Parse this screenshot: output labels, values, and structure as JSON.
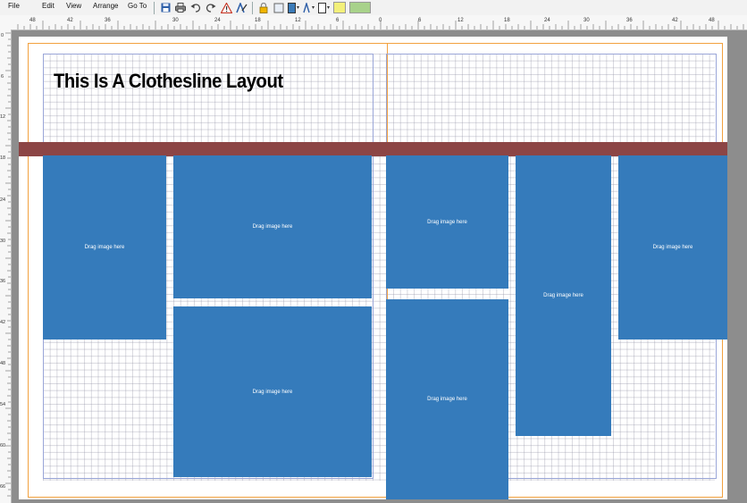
{
  "menu": {
    "file": "File",
    "edit": "Edit",
    "view": "View",
    "arrange": "Arrange",
    "goto": "Go To"
  },
  "toolbar": {
    "icons": [
      "save-icon",
      "print-icon",
      "undo-icon",
      "redo-icon",
      "warning-icon",
      "text-style-icon",
      "lock-icon",
      "fill-color-icon",
      "stroke-color-icon",
      "text-color-icon",
      "border-icon",
      "highlight-color-icon"
    ],
    "colors": {
      "fill": "#3b7bb8",
      "highlight": "#f3f07a",
      "green": "#a8d28a"
    }
  },
  "ruler": {
    "h_labels": [
      "48",
      "42",
      "36",
      "30",
      "24",
      "18",
      "12",
      "6",
      "0",
      "6",
      "12",
      "18",
      "24",
      "30",
      "36",
      "42",
      "48"
    ],
    "v_labels": [
      "0",
      "6",
      "12",
      "18",
      "24",
      "30",
      "36",
      "42",
      "48",
      "54",
      "60",
      "66"
    ]
  },
  "layout": {
    "title": "This Is A Clothesline Layout",
    "band_color": "#8c4545",
    "frame_color": "#357bbb",
    "frames": [
      {
        "label": "Drag image here"
      },
      {
        "label": "Drag image here"
      },
      {
        "label": "Drag image here"
      },
      {
        "label": "Drag image here"
      },
      {
        "label": "Drag image here"
      },
      {
        "label": "Drag image here"
      },
      {
        "label": "Drag image here"
      }
    ]
  }
}
